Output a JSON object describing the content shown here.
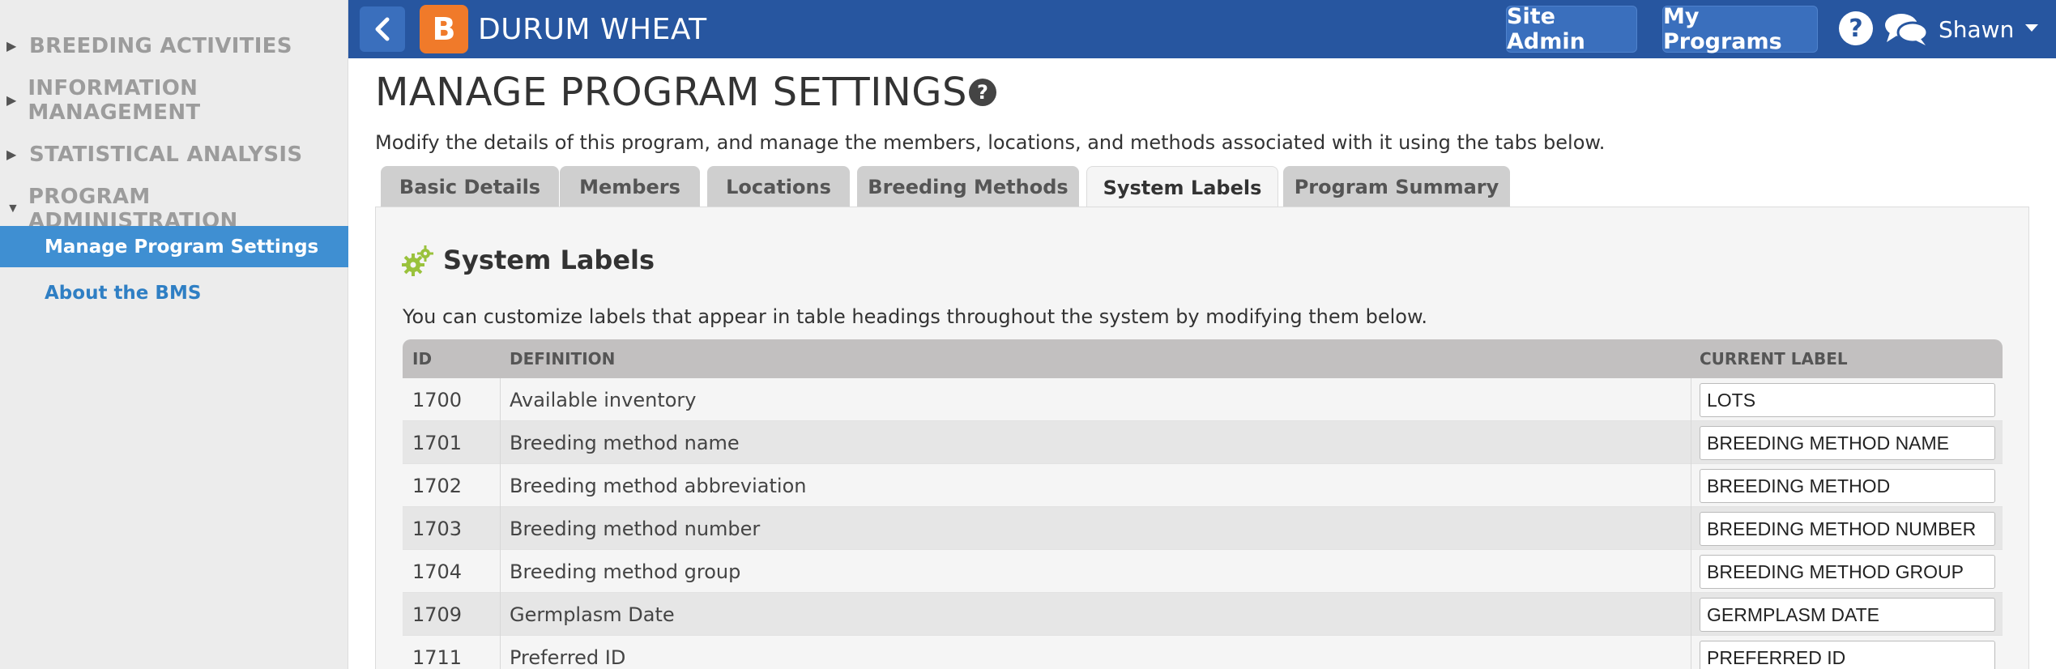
{
  "sidebar": {
    "sections": [
      {
        "label": "BREEDING ACTIVITIES",
        "expanded": false
      },
      {
        "label": "INFORMATION MANAGEMENT",
        "expanded": false
      },
      {
        "label": "STATISTICAL ANALYSIS",
        "expanded": false
      },
      {
        "label": "PROGRAM ADMINISTRATION",
        "expanded": true
      }
    ],
    "items": [
      {
        "label": "Manage Program Settings",
        "active": true
      },
      {
        "label": "About the BMS",
        "active": false
      }
    ]
  },
  "topbar": {
    "logo_letter": "B",
    "program_name": "DURUM WHEAT",
    "site_admin_label": "Site Admin",
    "my_programs_label": "My Programs",
    "help_glyph": "?",
    "user_name": "Shawn"
  },
  "page": {
    "title": "MANAGE PROGRAM SETTINGS",
    "help_glyph": "?",
    "intro": "Modify the details of this program, and manage the members, locations, and methods associated with it using the tabs below."
  },
  "tabs": [
    {
      "label": "Basic Details",
      "active": false
    },
    {
      "label": "Members",
      "active": false
    },
    {
      "label": "Locations",
      "active": false
    },
    {
      "label": "Breeding Methods",
      "active": false
    },
    {
      "label": "System Labels",
      "active": true
    },
    {
      "label": "Program Summary",
      "active": false
    }
  ],
  "panel": {
    "title": "System Labels",
    "description": "You can customize labels that appear in table headings throughout the system by modifying them below.",
    "columns": {
      "id": "ID",
      "definition": "DEFINITION",
      "current_label": "CURRENT LABEL"
    },
    "rows": [
      {
        "id": "1700",
        "definition": "Available inventory",
        "label": "LOTS"
      },
      {
        "id": "1701",
        "definition": "Breeding method name",
        "label": "BREEDING METHOD NAME"
      },
      {
        "id": "1702",
        "definition": "Breeding method abbreviation",
        "label": "BREEDING METHOD"
      },
      {
        "id": "1703",
        "definition": "Breeding method number",
        "label": "BREEDING METHOD NUMBER"
      },
      {
        "id": "1704",
        "definition": "Breeding method group",
        "label": "BREEDING METHOD GROUP"
      },
      {
        "id": "1709",
        "definition": "Germplasm Date",
        "label": "GERMPLASM DATE"
      },
      {
        "id": "1711",
        "definition": "Preferred ID",
        "label": "PREFERRED ID"
      }
    ]
  },
  "colors": {
    "topbar": "#2756a0",
    "accent": "#3f8fd2",
    "logo": "#f07a2a",
    "gear": "#9ac23c"
  }
}
